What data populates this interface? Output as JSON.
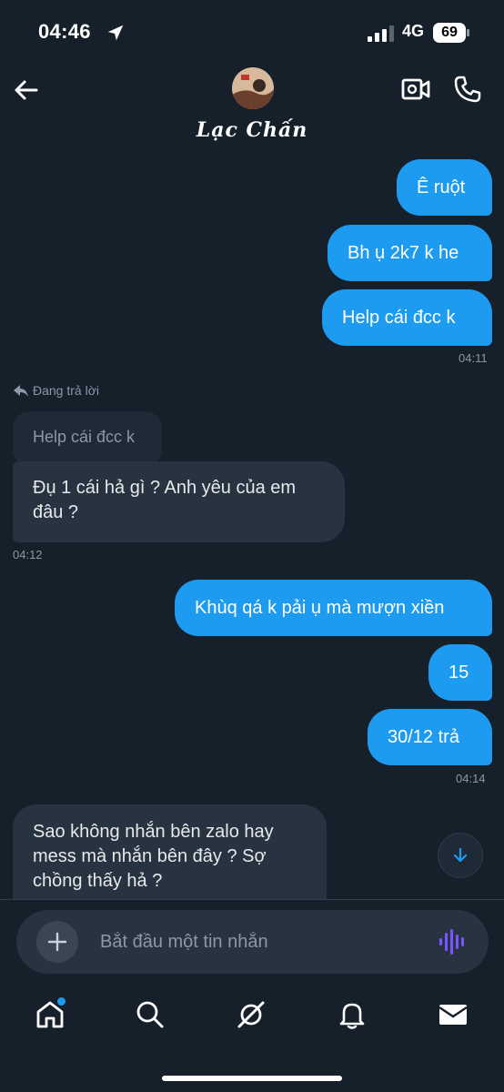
{
  "status_bar": {
    "time": "04:46",
    "network": "4G",
    "battery": "69"
  },
  "header": {
    "contact_name": "Lạc Chấn"
  },
  "messages": [
    {
      "id": "m1",
      "text": "Ê ruột"
    },
    {
      "id": "m2",
      "text": "Bh ụ 2k7 k he"
    },
    {
      "id": "m3",
      "text": "Help cái đcc k"
    },
    {
      "id": "t1",
      "text": "04:11"
    },
    {
      "id": "reply_label",
      "text": "Đang trả lời"
    },
    {
      "id": "quoted",
      "text": "Help cái đcc k"
    },
    {
      "id": "m4_line1",
      "text": "Đụ 1 cái hả gì ? Anh yêu của em"
    },
    {
      "id": "m4_line2",
      "text": "đâu ?"
    },
    {
      "id": "t2",
      "text": "04:12"
    },
    {
      "id": "m5",
      "text": "Khùq qá k pải ụ mà mượn xiền"
    },
    {
      "id": "m6",
      "text": "15"
    },
    {
      "id": "m7",
      "text": "30/12 trả"
    },
    {
      "id": "t3",
      "text": "04:14"
    },
    {
      "id": "m8_line1",
      "text": "Sao không nhắn bên zalo hay"
    },
    {
      "id": "m8_line2",
      "text": "mess mà nhắn bên đây ? Sợ"
    },
    {
      "id": "m8_line3",
      "text": "chồng thấy hả ?"
    }
  ],
  "composer": {
    "placeholder": "Bắt đầu một tin nhắn"
  },
  "nav": [
    "home-icon",
    "search-icon",
    "grok-icon",
    "bell-icon",
    "mail-icon"
  ],
  "colors": {
    "background": "#15202b",
    "outgoing": "#1d9bf0",
    "incoming": "#273340",
    "voice_accent": "#7856ff"
  }
}
